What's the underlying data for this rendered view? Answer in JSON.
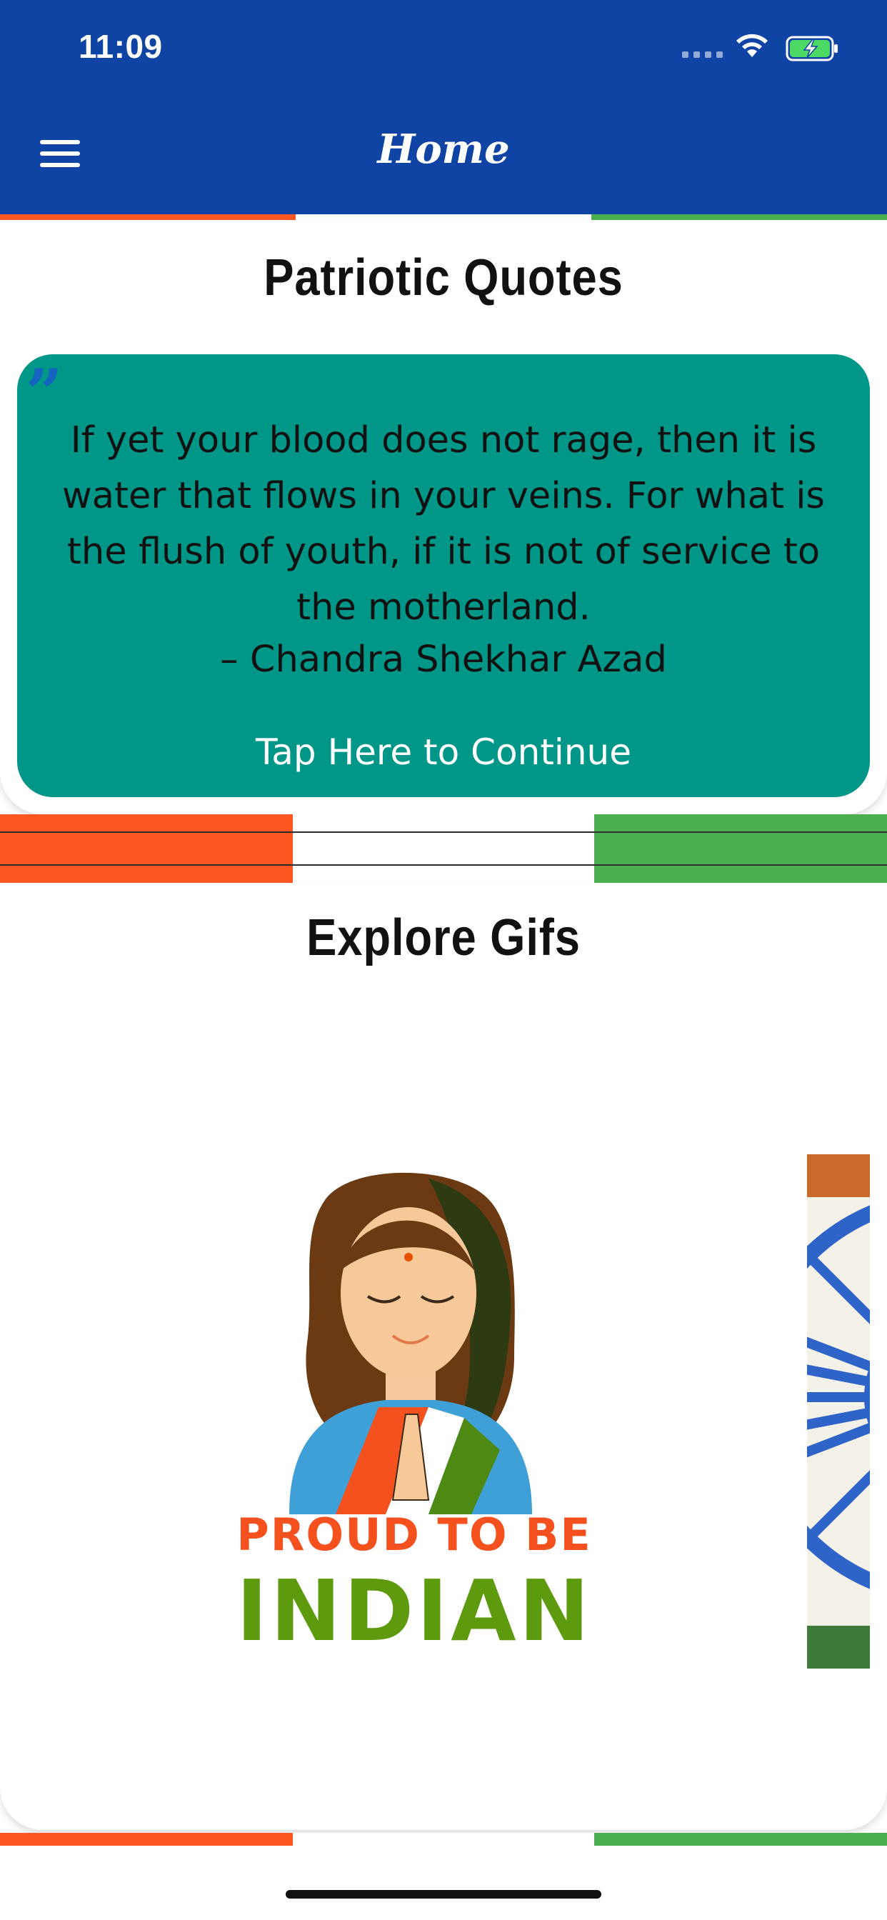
{
  "status_bar": {
    "time": "11:09"
  },
  "header": {
    "title": "Home",
    "menu_icon": "hamburger-menu-icon"
  },
  "colors": {
    "appbar": "#0F44A5",
    "saffron": "#FF5722",
    "green": "#4CAF50",
    "quote_bg": "#009688",
    "quote_mark": "#1565C0"
  },
  "quotes_section": {
    "title": "Patriotic Quotes",
    "quote_icon": "quote-mark-icon",
    "quote_lines": [
      "If yet your blood does not rage, then it is",
      "water that flows in your veins. For what is",
      "the flush of youth, if it is not of service to",
      "the motherland."
    ],
    "author": "– Chandra Shekhar Azad",
    "cta": "Tap Here to Continue"
  },
  "gifs_section": {
    "title": "Explore Gifs",
    "items": [
      {
        "caption_top": "PROUD TO BE",
        "caption_bottom": "INDIAN"
      }
    ]
  }
}
